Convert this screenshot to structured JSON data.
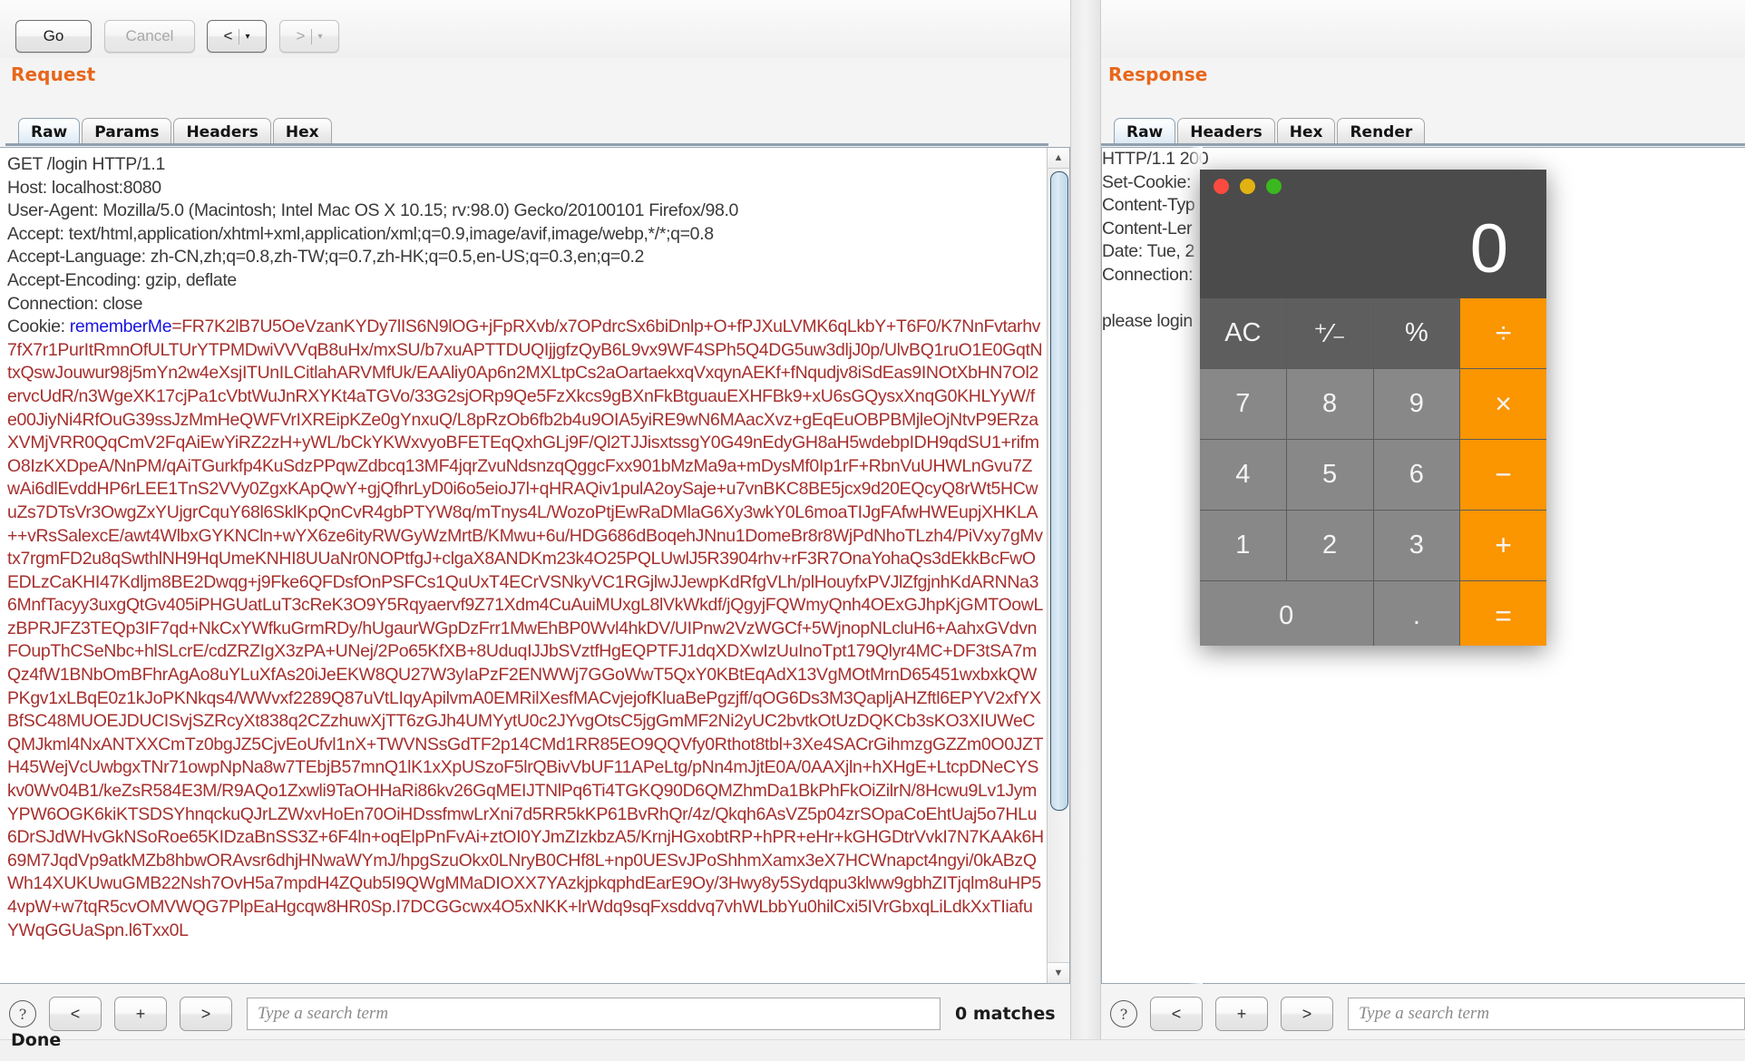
{
  "toolbar": {
    "go_label": "Go",
    "cancel_label": "Cancel",
    "back_glyph": "<",
    "forward_glyph": ">",
    "caret_glyph": "▾"
  },
  "request": {
    "title": "Request",
    "tabs": [
      "Raw",
      "Params",
      "Headers",
      "Hex"
    ],
    "active_tab": "Raw",
    "headers": "GET /login HTTP/1.1\nHost: localhost:8080\nUser-Agent: Mozilla/5.0 (Macintosh; Intel Mac OS X 10.15; rv:98.0) Gecko/20100101 Firefox/98.0\nAccept: text/html,application/xhtml+xml,application/xml;q=0.9,image/avif,image/webp,*/*;q=0.8\nAccept-Language: zh-CN,zh;q=0.8,zh-TW;q=0.7,zh-HK;q=0.5,en-US;q=0.3,en;q=0.2\nAccept-Encoding: gzip, deflate\nConnection: close\nCookie: ",
    "cookie_name": "rememberMe",
    "cookie_eq": "=",
    "cookie_value": "FR7K2lB7U5OeVzanKYDy7lIS6N9lOG+jFpRXvb/x7OPdrcSx6biDnlp+O+fPJXuLVMK6qLkbY+T6F0/K7NnFvtarhv7fX7r1PurItRmnOfULTUrYTPMDwiVVVqB8uHx/mxSU/b7xuAPTTDUQIjjgfzQyB6L9vx9WF4SPh5Q4DG5uw3dljJ0p/UlvBQ1ruO1E0GqtNtxQswJouwur98j5mYn2w4eXsjITUnILCitlahARVMfUk/EAAliy0Ap6n2MXLtpCs2aOartaekxqVxqynAEKf+fNqudjv8iSdEas9INOtXbHN7Ol2ervcUdR/n3WgeXK17cjPa1cVbtWuJnRXYKt4aTGVo/33G2sjORp9Qe5FzXkcs9gBXnFkBtguauEXHFBk9+xU6sGQysxXnqG0KHLYyW/fe00JiyNi4RfOuG39ssJzMmHeQWFVrIXREipKZe0gYnxuQ/L8pRzOb6fb2b4u9OIA5yiRE9wN6MAacXvz+gEqEuOBPBMjleOjNtvP9ERzaXVMjVRR0QqCmV2FqAiEwYiRZ2zH+yWL/bCkYKWxvyoBFETEqQxhGLj9F/Ql2TJJisxtssgY0G49nEdyGH8aH5wdebpIDH9qdSU1+rifmO8IzKXDpeA/NnPM/qAiTGurkfp4KuSdzPPqwZdbcq13MF4jqrZvuNdsnzqQggcFxx901bMzMa9a+mDysMf0Ip1rF+RbnVuUHWLnGvu7ZwAi6dlEvddHP6rLEE1TnS2VVy0ZgxKApQwY+gjQfhrLyD0i6o5eioJ7l+qHRAQiv1pulA2oySaje+u7vnBKC8BE5jcx9d20EQcyQ8rWt5HCwuZs7DTsVr3OwgZxYUjgrCquY68l6SklKpQnCvR4gbPTYW8q/mTnys4L/WozoPtjEwRaDMlaG6Xy3wkY0L6moaTIJgFAfwHWEupjXHKLA++vRsSalexcE/awt4WlbxGYKNCln+wYX6ze6ityRWGyWzMrtB/KMwu+6u/HDG686dBoqehJNnu1DomeBr8r8WjPdNhoTLzh4/PiVxy7gMvtx7rgmFD2u8qSwthlNH9HqUmeKNHI8UUaNr0NOPtfgJ+clgaX8ANDKm23k4O25PQLUwlJ5R3904rhv+rF3R7OnaYohaQs3dEkkBcFwOEDLzCaKHI47Kdljm8BE2Dwqg+j9Fke6QFDsfOnPSFCs1QuUxT4ECrVSNkyVC1RGjlwJJewpKdRfgVLh/plHouyfxPVJlZfgjnhKdARNNa36MnfTacyy3uxgQtGv405iPHGUatLuT3cReK3O9Y5Rqyaervf9Z71Xdm4CuAuiMUxgL8lVkWkdf/jQgyjFQWmyQnh4OExGJhpKjGMTOowLzBPRJFZ3TEQp3IF7qd+NkCxYWfkuGrmRDy/hUgaurWGpDzFrr1MwEhBP0Wvl4hkDV/UIPnw2VzWGCf+5WjnopNLcluH6+AahxGVdvnFOupThCSeNbc+hlSLcrE/cdZRZIgX3zPA+UNej/2Po65KfXB+8UduqIJJbSVztfHgEQPTFJ1dqXDXwIzUuInoTpt179Qlyr4MC+DF3tSA7mQz4fW1BNbOmBFhrAgAo8uYLuXfAs20iJeEKW8QU27W3yIaPzF2ENWWj7GGoWwT5QxY0KBtEqAdX13VgMOtMrnD65451wxbxkQWPKgv1xLBqE0z1kJoPKNkqs4/WWvxf2289Q87uVtLIqyApilvmA0EMRilXesfMACvjejofKluaBePgzjff/qOG6Ds3M3QapljAHZftl6EPYV2xfYXBfSC48MUOEJDUCISvjSZRcyXt838q2CZzhuwXjTT6zGJh4UMYytU0c2JYvgOtsC5jgGmMF2Ni2yUC2bvtkOtUzDQKCb3sKO3XIUWeCQMJkml4NxANTXXCmTz0bgJZ5CjvEoUfvl1nX+TWVNSsGdTF2p14CMd1RR85EO9QQVfy0Rthot8tbl+3Xe4SACrGihmzgGZZm0O0JZTH45WejVcUwbgxTNr71owpNpNa8w7TEbjB57mnQ1lK1xXpUSzoF5lrQBivVbUF11APeLtg/pNn4mJjtE0A/0AAXjln+hXHgE+LtcpDNeCYSkv0Wv04B1/keZsR584E3M/R9AQo1Zxwli9TaOHHaRi86kv26GqMEIJTNlPq6Ti4TGKQ90D6QMZhmDa1BkPhFkOiZilrN/8Hcwu9Lv1JymYPW6OGK6kiKTSDSYhnqckuQJrLZWxvHoEn70OiHDssfmwLrXni7d5RR5kKP61BvRhQr/4z/Qkqh6AsVZ5p04zrSOpaCoEhtUaj5o7HLu6DrSJdWHvGkNSoRoe65KIDzaBnSS3Z+6F4ln+oqElpPnFvAi+ztOI0YJmZIzkbzA5/KrnjHGxobtRP+hPR+eHr+kGHGDtrVvkI7N7KAAk6H69M7JqdVp9atkMZb8hbwORAvsr6dhjHNwaWYmJ/hpgSzuOkx0LNryB0CHf8L+np0UESvJPoShhmXamx3eX7HCWnapct4ngyi/0kABzQWh14XUKUwuGMB22Nsh7OvH5a7mpdH4ZQub5I9QWgMMaDIOXX7YAzkjpkqphdEarE9Oy/3Hwy8y5Sydqpu3klww9gbhZITjqlm8uHP54vpW+w7tqR5cvOMVWQG7PlpEaHgcqw8HR0Sp.I7DCGGcwx4O5xNKK+lrWdq9sqFxsddvq7vhWLbbYu0hilCxi5IVrGbxqLiLdkXxTIiafuYWqGGUaSpn.l6Txx0L",
    "search_placeholder": "Type a search term",
    "matches": "0 matches",
    "nav_prev": "<",
    "nav_add": "+",
    "nav_next": ">",
    "help_glyph": "?"
  },
  "response": {
    "title": "Response",
    "tabs": [
      "Raw",
      "Headers",
      "Hex",
      "Render"
    ],
    "active_tab": "Raw",
    "body": "HTTP/1.1 200\nSet-Cookie:                                      Age=0; Expires=Mon, 2\nContent-Typ\nContent-Ler\nDate: Tue, 2\nConnection:\n\nplease login",
    "search_placeholder": "Type a search term",
    "nav_prev": "<",
    "nav_add": "+",
    "nav_next": ">",
    "help_glyph": "?"
  },
  "status": {
    "text": "Done"
  },
  "calculator": {
    "display": "0",
    "keys": [
      {
        "label": "AC",
        "type": "fn"
      },
      {
        "label": "⁺⁄₋",
        "type": "fn"
      },
      {
        "label": "%",
        "type": "fn"
      },
      {
        "label": "÷",
        "type": "op"
      },
      {
        "label": "7",
        "type": "num"
      },
      {
        "label": "8",
        "type": "num"
      },
      {
        "label": "9",
        "type": "num"
      },
      {
        "label": "×",
        "type": "op"
      },
      {
        "label": "4",
        "type": "num"
      },
      {
        "label": "5",
        "type": "num"
      },
      {
        "label": "6",
        "type": "num"
      },
      {
        "label": "−",
        "type": "op"
      },
      {
        "label": "1",
        "type": "num"
      },
      {
        "label": "2",
        "type": "num"
      },
      {
        "label": "3",
        "type": "num"
      },
      {
        "label": "+",
        "type": "op"
      },
      {
        "label": "0",
        "type": "num wide"
      },
      {
        "label": ".",
        "type": "num"
      },
      {
        "label": "=",
        "type": "op"
      }
    ]
  },
  "colors": {
    "accent": "#e8661b",
    "cookie_name": "#1a14e0",
    "cookie_value": "#a6302e",
    "calc_op": "#fb9500"
  }
}
